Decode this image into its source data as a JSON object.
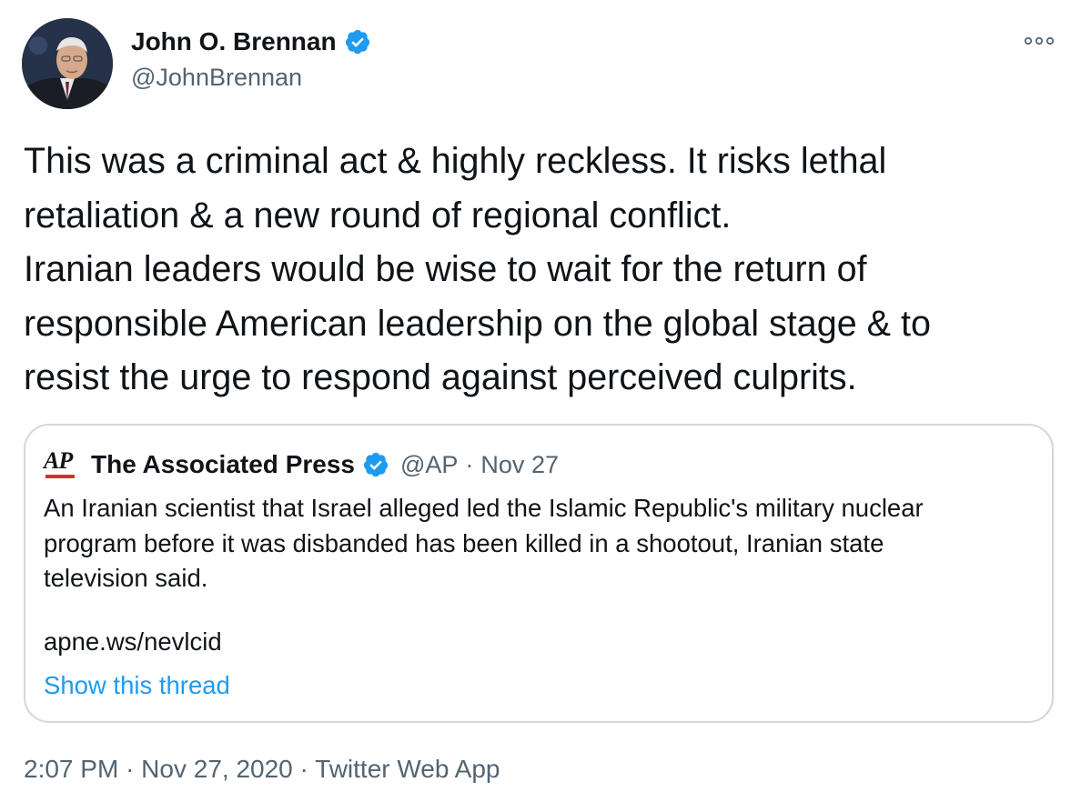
{
  "author": {
    "name": "John O. Brennan",
    "handle": "@JohnBrennan"
  },
  "tweet": {
    "lines": [
      "This was a criminal act & highly reckless. It risks lethal",
      "retaliation & a new round of regional conflict.",
      "Iranian leaders would be wise to wait for the return of",
      "responsible American leadership on the global stage & to",
      "resist the urge to respond against perceived culprits."
    ]
  },
  "quote": {
    "logo_text": "AP",
    "name": "The Associated Press",
    "handle": "@AP",
    "separator": "·",
    "date": "Nov 27",
    "lines": [
      "An Iranian scientist that Israel alleged led the Islamic Republic's military nuclear",
      "program before it was disbanded has been killed in a shootout, Iranian state",
      "television said."
    ],
    "link": "apne.ws/nevlcid",
    "show_thread": "Show this thread"
  },
  "footer": {
    "time": "2:07 PM",
    "sep1": "·",
    "date": "Nov 27, 2020",
    "sep2": "·",
    "app": "Twitter Web App"
  },
  "colors": {
    "verified": "#1d9bf0",
    "link": "#1d9bf0",
    "secondary_text": "#536471",
    "border": "#cfd9de",
    "ap_red": "#e0282f"
  },
  "icons": {
    "verified": "verified-badge-icon",
    "more": "more-options-icon"
  }
}
